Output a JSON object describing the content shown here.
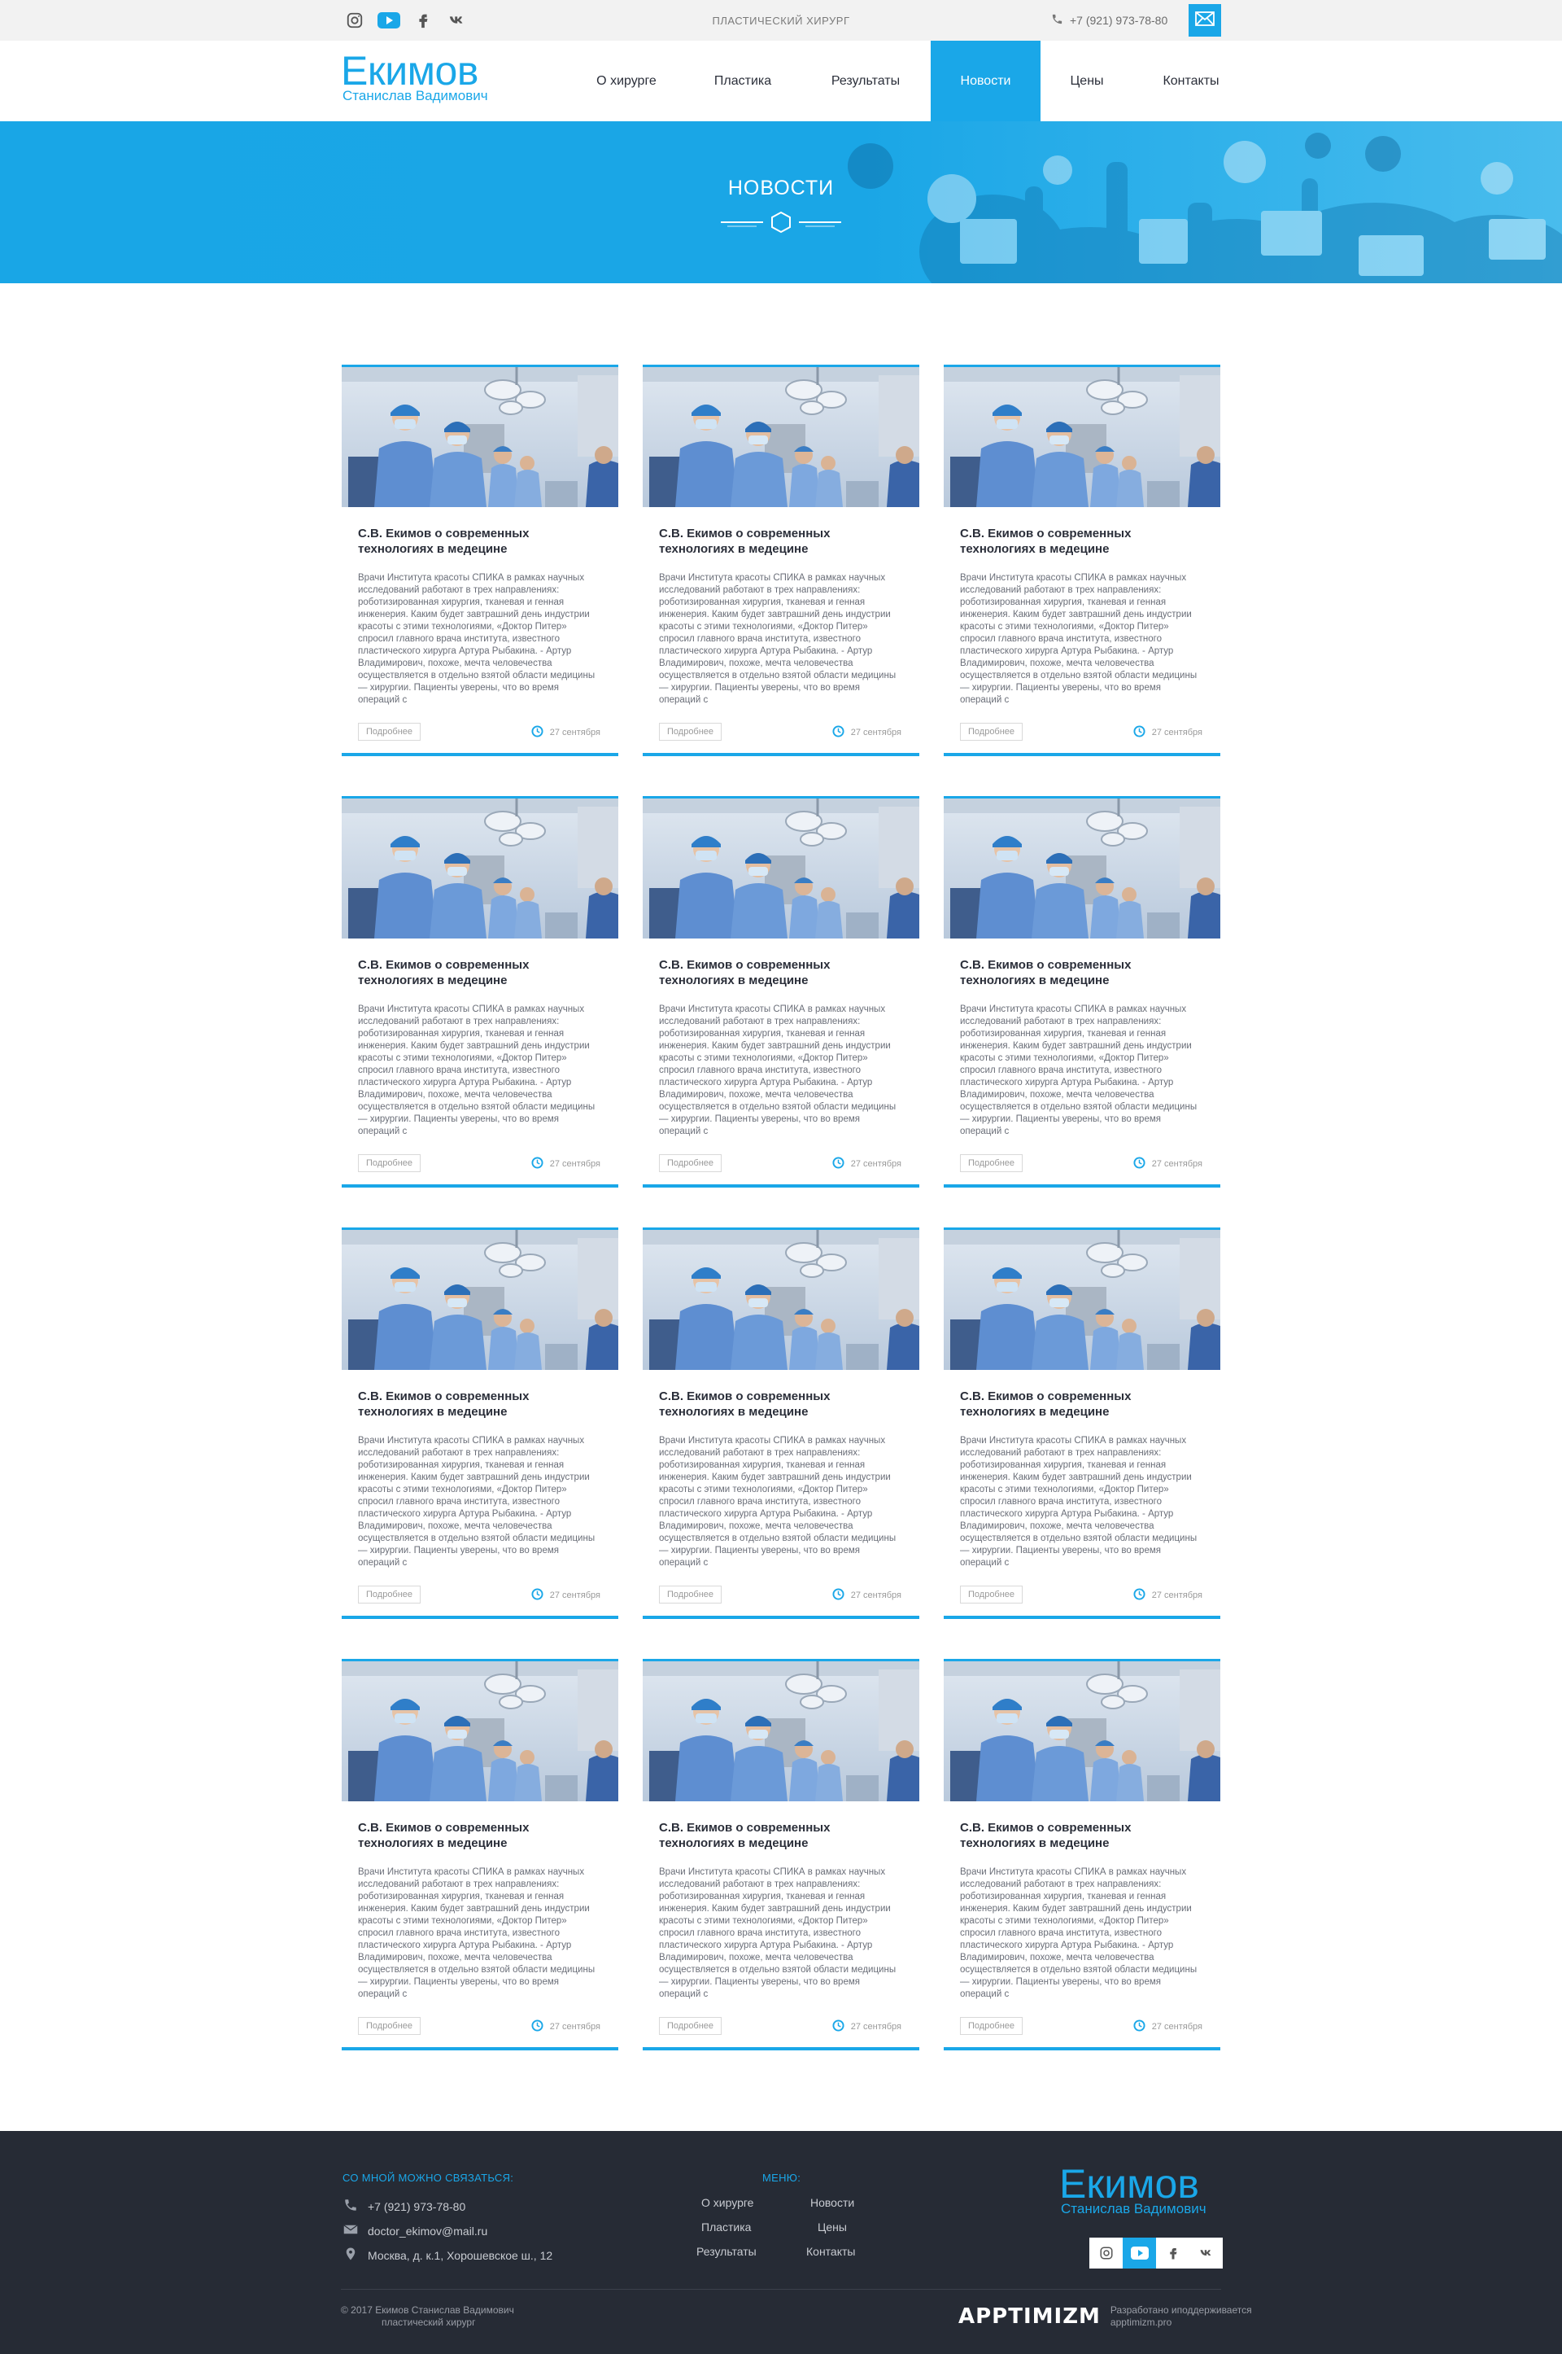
{
  "colors": {
    "accent": "#1aa7e8",
    "footer_bg": "#262b35",
    "topbar_bg": "#f2f2f2"
  },
  "topbar": {
    "social": [
      "instagram-icon",
      "youtube-icon",
      "facebook-icon",
      "vk-icon"
    ],
    "tagline": "ПЛАСТИЧЕСКИЙ ХИРУРГ",
    "phone": "+7 (921) 973-78-80",
    "mail_icon": "mail-icon"
  },
  "logo": {
    "last_name": "Екимов",
    "full_name": "Станислав Вадимович"
  },
  "nav": [
    {
      "label": "О хирурге",
      "active": false
    },
    {
      "label": "Пластика",
      "active": false
    },
    {
      "label": "Результаты",
      "active": false
    },
    {
      "label": "Новости",
      "active": true
    },
    {
      "label": "Цены",
      "active": false
    },
    {
      "label": "Контакты",
      "active": false
    }
  ],
  "hero": {
    "title": "НОВОСТИ"
  },
  "news": {
    "cards": [
      {
        "title": "С.В. Екимов о современных технологиях в медецине",
        "text": "Врачи Института красоты СПИКА в рамках научных исследований работают в трех направлениях: роботизированная хирургия, тканевая и генная инженерия. Каким будет завтрашний день индустрии красоты с этими технологиями, «Доктор Питер» спросил главного врача института, известного пластического хирурга Артура Рыбакина. - Артур Владимирович, похоже, мечта человечества осуществляется в отдельно взятой области медицины — хирургии. Пациенты уверены, что во время операций с",
        "more": "Подробнее",
        "date": "27 сентября"
      },
      {
        "title": "С.В. Екимов о современных технологиях в медецине",
        "text": "Врачи Института красоты СПИКА в рамках научных исследований работают в трех направлениях: роботизированная хирургия, тканевая и генная инженерия. Каким будет завтрашний день индустрии красоты с этими технологиями, «Доктор Питер» спросил главного врача института, известного пластического хирурга Артура Рыбакина. - Артур Владимирович, похоже, мечта человечества осуществляется в отдельно взятой области медицины — хирургии. Пациенты уверены, что во время операций с",
        "more": "Подробнее",
        "date": "27 сентября"
      },
      {
        "title": "С.В. Екимов о современных технологиях в медецине",
        "text": "Врачи Института красоты СПИКА в рамках научных исследований работают в трех направлениях: роботизированная хирургия, тканевая и генная инженерия. Каким будет завтрашний день индустрии красоты с этими технологиями, «Доктор Питер» спросил главного врача института, известного пластического хирурга Артура Рыбакина. - Артур Владимирович, похоже, мечта человечества осуществляется в отдельно взятой области медицины — хирургии. Пациенты уверены, что во время операций с",
        "more": "Подробнее",
        "date": "27 сентября"
      },
      {
        "title": "С.В. Екимов о современных технологиях в медецине",
        "text": "Врачи Института красоты СПИКА в рамках научных исследований работают в трех направлениях: роботизированная хирургия, тканевая и генная инженерия. Каким будет завтрашний день индустрии красоты с этими технологиями, «Доктор Питер» спросил главного врача института, известного пластического хирурга Артура Рыбакина. - Артур Владимирович, похоже, мечта человечества осуществляется в отдельно взятой области медицины — хирургии. Пациенты уверены, что во время операций с",
        "more": "Подробнее",
        "date": "27 сентября"
      },
      {
        "title": "С.В. Екимов о современных технологиях в медецине",
        "text": "Врачи Института красоты СПИКА в рамках научных исследований работают в трех направлениях: роботизированная хирургия, тканевая и генная инженерия. Каким будет завтрашний день индустрии красоты с этими технологиями, «Доктор Питер» спросил главного врача института, известного пластического хирурга Артура Рыбакина. - Артур Владимирович, похоже, мечта человечества осуществляется в отдельно взятой области медицины — хирургии. Пациенты уверены, что во время операций с",
        "more": "Подробнее",
        "date": "27 сентября"
      },
      {
        "title": "С.В. Екимов о современных технологиях в медецине",
        "text": "Врачи Института красоты СПИКА в рамках научных исследований работают в трех направлениях: роботизированная хирургия, тканевая и генная инженерия. Каким будет завтрашний день индустрии красоты с этими технологиями, «Доктор Питер» спросил главного врача института, известного пластического хирурга Артура Рыбакина. - Артур Владимирович, похоже, мечта человечества осуществляется в отдельно взятой области медицины — хирургии. Пациенты уверены, что во время операций с",
        "more": "Подробнее",
        "date": "27 сентября"
      },
      {
        "title": "С.В. Екимов о современных технологиях в медецине",
        "text": "Врачи Института красоты СПИКА в рамках научных исследований работают в трех направлениях: роботизированная хирургия, тканевая и генная инженерия. Каким будет завтрашний день индустрии красоты с этими технологиями, «Доктор Питер» спросил главного врача института, известного пластического хирурга Артура Рыбакина. - Артур Владимирович, похоже, мечта человечества осуществляется в отдельно взятой области медицины — хирургии. Пациенты уверены, что во время операций с",
        "more": "Подробнее",
        "date": "27 сентября"
      },
      {
        "title": "С.В. Екимов о современных технологиях в медецине",
        "text": "Врачи Института красоты СПИКА в рамках научных исследований работают в трех направлениях: роботизированная хирургия, тканевая и генная инженерия. Каким будет завтрашний день индустрии красоты с этими технологиями, «Доктор Питер» спросил главного врача института, известного пластического хирурга Артура Рыбакина. - Артур Владимирович, похоже, мечта человечества осуществляется в отдельно взятой области медицины — хирургии. Пациенты уверены, что во время операций с",
        "more": "Подробнее",
        "date": "27 сентября"
      },
      {
        "title": "С.В. Екимов о современных технологиях в медецине",
        "text": "Врачи Института красоты СПИКА в рамках научных исследований работают в трех направлениях: роботизированная хирургия, тканевая и генная инженерия. Каким будет завтрашний день индустрии красоты с этими технологиями, «Доктор Питер» спросил главного врача института, известного пластического хирурга Артура Рыбакина. - Артур Владимирович, похоже, мечта человечества осуществляется в отдельно взятой области медицины — хирургии. Пациенты уверены, что во время операций с",
        "more": "Подробнее",
        "date": "27 сентября"
      },
      {
        "title": "С.В. Екимов о современных технологиях в медецине",
        "text": "Врачи Института красоты СПИКА в рамках научных исследований работают в трех направлениях: роботизированная хирургия, тканевая и генная инженерия. Каким будет завтрашний день индустрии красоты с этими технологиями, «Доктор Питер» спросил главного врача института, известного пластического хирурга Артура Рыбакина. - Артур Владимирович, похоже, мечта человечества осуществляется в отдельно взятой области медицины — хирургии. Пациенты уверены, что во время операций с",
        "more": "Подробнее",
        "date": "27 сентября"
      },
      {
        "title": "С.В. Екимов о современных технологиях в медецине",
        "text": "Врачи Института красоты СПИКА в рамках научных исследований работают в трех направлениях: роботизированная хирургия, тканевая и генная инженерия. Каким будет завтрашний день индустрии красоты с этими технологиями, «Доктор Питер» спросил главного врача института, известного пластического хирурга Артура Рыбакина. - Артур Владимирович, похоже, мечта человечества осуществляется в отдельно взятой области медицины — хирургии. Пациенты уверены, что во время операций с",
        "more": "Подробнее",
        "date": "27 сентября"
      },
      {
        "title": "С.В. Екимов о современных технологиях в медецине",
        "text": "Врачи Института красоты СПИКА в рамках научных исследований работают в трех направлениях: роботизированная хирургия, тканевая и генная инженерия. Каким будет завтрашний день индустрии красоты с этими технологиями, «Доктор Питер» спросил главного врача института, известного пластического хирурга Артура Рыбакина. - Артур Владимирович, похоже, мечта человечества осуществляется в отдельно взятой области медицины — хирургии. Пациенты уверены, что во время операций с",
        "more": "Подробнее",
        "date": "27 сентября"
      }
    ]
  },
  "footer": {
    "contact_heading": "СО МНОЙ МОЖНО СВЯЗАТЬСЯ:",
    "phone": "+7 (921) 973-78-80",
    "email": "doctor_ekimov@mail.ru",
    "address": "Москва, д. к.1, Хорошевское ш., 12",
    "menu_heading": "МЕНЮ:",
    "menu": [
      "О хирурге",
      "Новости",
      "Пластика",
      "Цены",
      "Результаты",
      "Контакты"
    ],
    "logo_last_name": "Екимов",
    "logo_full_name": "Станислав Вадимович",
    "social": [
      "instagram-icon",
      "youtube-icon",
      "facebook-icon",
      "vk-icon"
    ],
    "copyright_line1": "© 2017 Екимов Станислав Вадимович",
    "copyright_line2": "пластический хирург",
    "dev_logo": "APPTIMIZM",
    "dev_line1": "Разработано иподдерживается",
    "dev_line2": "apptimizm.pro"
  }
}
